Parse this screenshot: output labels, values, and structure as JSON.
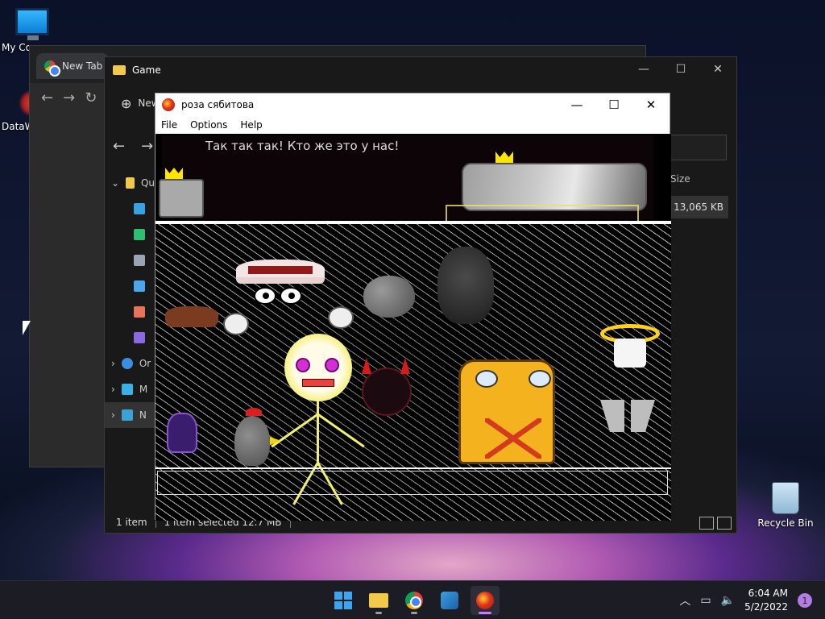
{
  "desktop": {
    "icons": [
      {
        "label": "My Co"
      },
      {
        "label": "DataW"
      },
      {
        "label": "Recycle Bin"
      }
    ]
  },
  "browser": {
    "tab_label": "New Tab",
    "new_button_label": "Ne"
  },
  "explorer": {
    "title": "Game",
    "new_button_label": "New",
    "nav_items": [
      "Qu",
      "",
      "",
      "",
      "",
      "",
      "",
      "Or",
      "M",
      "N"
    ],
    "column_size": "Size",
    "file_size": "13,065 KB",
    "status_items": "1 item",
    "status_selected": "1 item selected  12.7 MB"
  },
  "game": {
    "title": "роза сябитова",
    "menu": [
      "File",
      "Options",
      "Help"
    ],
    "dialog_text": "Так так так! Кто же это у нас!"
  },
  "taskbar": {
    "time": "6:04 AM",
    "date": "5/2/2022",
    "notification_count": "1",
    "apps": [
      "start",
      "file-explorer",
      "chrome",
      "app",
      "game"
    ]
  },
  "colors": {
    "accent": "#c77dff",
    "start_blue": "#3ca5f0",
    "folder_yellow": "#f2c94c"
  }
}
